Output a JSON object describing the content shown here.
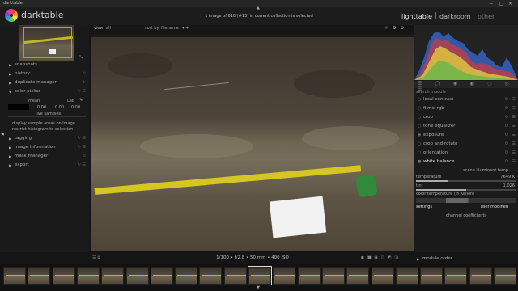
{
  "window": {
    "app": "darktable",
    "minimize": "–",
    "maximize": "□",
    "close": "×"
  },
  "header": {
    "brand": "darktable",
    "collection_info": "1 image of 610 (#13) in current collection is selected",
    "views": [
      "lighttable",
      "darkroom",
      "other"
    ],
    "separator": "|"
  },
  "filterbar": {
    "view_label": "view",
    "view_value": "all",
    "sort_label": "sort by",
    "sort_value": "filename"
  },
  "left": {
    "modules": [
      "snapshots",
      "history",
      "duplicate manager",
      "color picker"
    ],
    "color_picker": {
      "mode": "mean",
      "space": "Lab",
      "values": [
        "0.00",
        "0.00",
        "0.00"
      ],
      "live_samples": "live samples",
      "option1": "display sample areas on image",
      "option2": "restrict histogram to selection"
    },
    "modules2": [
      "tagging",
      "image information",
      "mask manager",
      "export"
    ]
  },
  "image_info": "1/100 • f/2.8 • 50 mm • 400 ISO",
  "right": {
    "search_placeholder": "search module",
    "modules": [
      "local contrast",
      "filmic rgb",
      "crop",
      "tone equalizer",
      "exposure",
      "crop and rotate",
      "orientation",
      "white balance"
    ],
    "white_balance": {
      "scene_illuminant": "scene illuminant temp",
      "temperature_label": "temperature",
      "temperature_value": "7649 K",
      "tint_label": "tint",
      "tint_value": "1.026",
      "section": "color temperature (in Kelvin)",
      "settings_label": "settings",
      "settings_value": "user modified",
      "channel": "channel coefficients"
    },
    "module_order": "module order"
  },
  "filmstrip": {
    "count": 21,
    "selected": 10
  },
  "colors": {
    "bg": "#151515",
    "panel": "#1a1a1a",
    "active": "#cccccc",
    "tape": "#d5c624"
  }
}
